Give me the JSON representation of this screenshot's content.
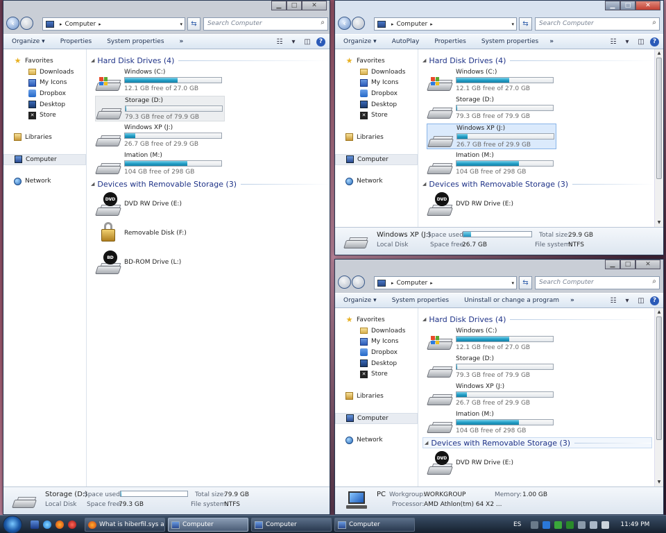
{
  "common": {
    "address": "Computer",
    "search_placeholder": "Search Computer",
    "hdd_header": "Hard Disk Drives (4)",
    "removable_header": "Devices with Removable Storage (3)",
    "nav": {
      "favorites": "Favorites",
      "downloads": "Downloads",
      "my_icons": "My Icons",
      "dropbox": "Dropbox",
      "desktop": "Desktop",
      "store": "Store",
      "libraries": "Libraries",
      "computer": "Computer",
      "network": "Network"
    },
    "drives": [
      {
        "name": "Windows (C:)",
        "free": "12.1 GB free of 27.0 GB",
        "used_fraction": 0.55
      },
      {
        "name": "Storage (D:)",
        "free": "79.3 GB free of 79.9 GB",
        "used_fraction": 0.01
      },
      {
        "name": "Windows XP (J:)",
        "free": "26.7 GB free of 29.9 GB",
        "used_fraction": 0.11
      },
      {
        "name": "Imation (M:)",
        "free": "104 GB free of 298 GB",
        "used_fraction": 0.65
      }
    ],
    "removable": [
      {
        "name": "DVD RW Drive (E:)",
        "icon_label": "DVD"
      },
      {
        "name": "Removable Disk (F:)"
      },
      {
        "name": "BD-ROM Drive (L:)",
        "icon_label": "BD"
      }
    ],
    "details_labels": {
      "space_used": "Space used:",
      "space_free": "Space free:",
      "total_size": "Total size:",
      "file_system": "File system:"
    }
  },
  "toolbars": {
    "w1": [
      "Organize ▾",
      "Properties",
      "System properties",
      "»"
    ],
    "w2": [
      "Organize ▾",
      "AutoPlay",
      "Properties",
      "System properties",
      "»"
    ],
    "w3": [
      "Organize ▾",
      "System properties",
      "Uninstall or change a program",
      "»"
    ]
  },
  "details_w1": {
    "name": "Storage (D:)",
    "type": "Local Disk",
    "space_free": "79.3 GB",
    "total_size": "79.9 GB",
    "file_system": "NTFS",
    "used_fraction": 0.01
  },
  "details_w2": {
    "name": "Windows XP (J:)",
    "type": "Local Disk",
    "space_free": "26.7 GB",
    "total_size": "29.9 GB",
    "file_system": "NTFS",
    "used_fraction": 0.11
  },
  "details_w3": {
    "name": "PC",
    "workgroup_label": "Workgroup:",
    "workgroup": "WORKGROUP",
    "memory_label": "Memory:",
    "memory": "1.00 GB",
    "processor_label": "Processor:",
    "processor": "AMD Athlon(tm) 64 X2 ..."
  },
  "taskbar": {
    "tasks": [
      "What is hiberfil.sys a...",
      "Computer",
      "Computer",
      "Computer"
    ],
    "language": "ES",
    "clock": "11:49 PM"
  },
  "colors": {
    "accent": "#1e3287",
    "bar_fill": "#25a0c8"
  }
}
